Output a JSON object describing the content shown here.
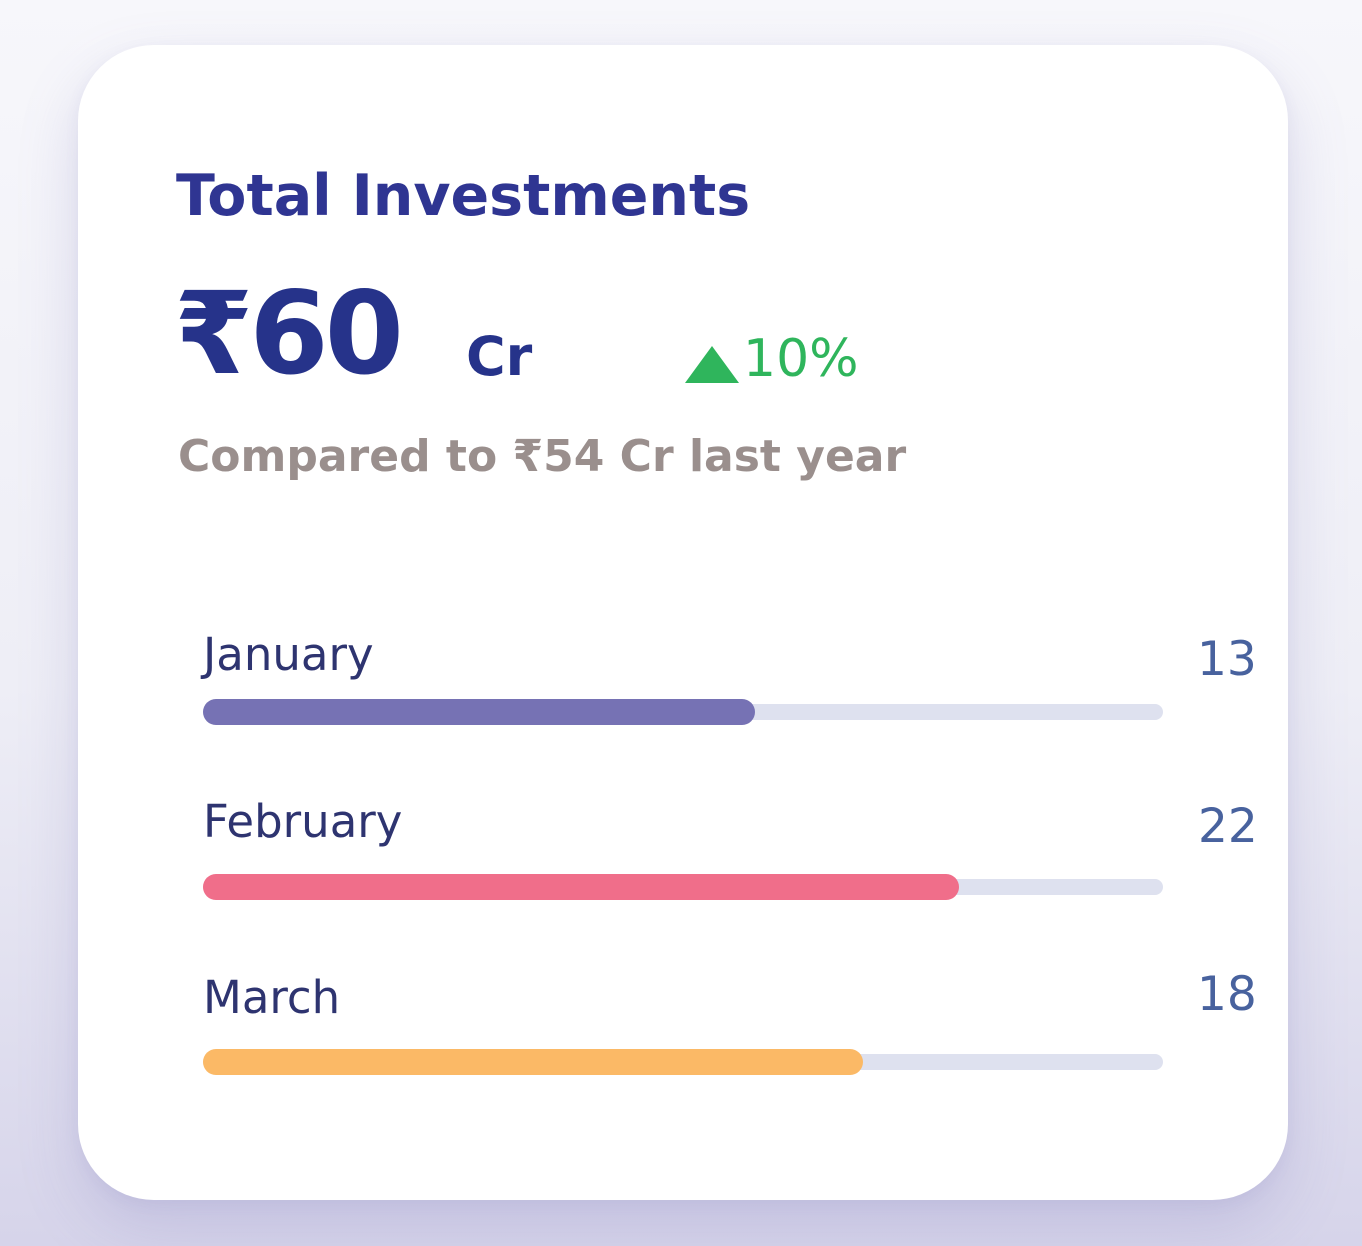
{
  "card": {
    "title": "Total Investments",
    "amount": "₹60",
    "unit": "Cr",
    "change": "10%",
    "change_icon": "triangle-up-icon",
    "compare_text": "Compared to ₹54 Cr last year"
  },
  "months": [
    {
      "label": "January",
      "value": "13",
      "progress": 0.575,
      "color": "#7672b4"
    },
    {
      "label": "February",
      "value": "22",
      "progress": 0.787,
      "color": "#f06e8a"
    },
    {
      "label": "March",
      "value": "18",
      "progress": 0.687,
      "color": "#fbb966"
    }
  ],
  "colors": {
    "accent": "#26338a",
    "positive": "#2fb55c",
    "track": "#dee1ef"
  }
}
